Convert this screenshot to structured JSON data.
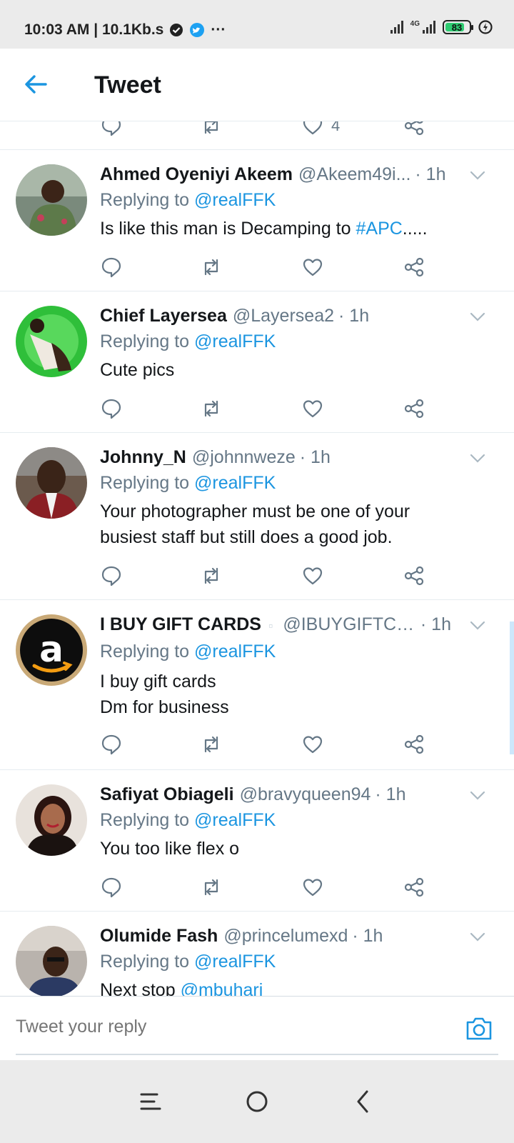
{
  "status_bar": {
    "time_speed": "10:03 AM | 10.1Kb.s",
    "more": "···",
    "network_type": "4G",
    "battery_level": "83"
  },
  "header": {
    "title": "Tweet"
  },
  "top_partial": {
    "like_count": "4"
  },
  "tweets": [
    {
      "name": "Ahmed Oyeniyi Akeem",
      "handle": "@Akeem49i...",
      "time": "· 1h",
      "replying_prefix": "Replying to",
      "replying_to": "@realFFK",
      "text_lines": [
        "Is like this man is Decamping to "
      ],
      "hashtag": "#APC",
      "text_suffix": "....."
    },
    {
      "name": "Chief Layersea",
      "handle": "@Layersea2",
      "time": "· 1h",
      "replying_prefix": "Replying to",
      "replying_to": "@realFFK",
      "text_lines": [
        "Cute pics"
      ]
    },
    {
      "name": "Johnny_N",
      "handle": "@johnnweze",
      "time": "· 1h",
      "replying_prefix": "Replying to",
      "replying_to": "@realFFK",
      "text_lines": [
        "Your photographer must be one of your",
        "busiest staff but still does a good job."
      ]
    },
    {
      "name": "I BUY GIFT CARDS",
      "handle": "@IBUYGIFTCA...",
      "time": "· 1h",
      "replying_prefix": "Replying to",
      "replying_to": "@realFFK",
      "text_lines": [
        "I buy gift cards",
        "Dm for business"
      ]
    },
    {
      "name": "Safiyat Obiageli",
      "handle": "@bravyqueen94",
      "time": "· 1h",
      "replying_prefix": "Replying to",
      "replying_to": "@realFFK",
      "text_lines": [
        "You too like flex o"
      ]
    },
    {
      "name": "Olumide Fash",
      "handle": "@princelumexd",
      "time": "· 1h",
      "replying_prefix": "Replying to",
      "replying_to": "@realFFK",
      "text_prefix": "Next stop ",
      "text_mention": "@mbuhari"
    }
  ],
  "composer": {
    "placeholder": "Tweet your reply"
  },
  "icons": {
    "back": "back-arrow-icon",
    "reply": "reply-icon",
    "retweet": "retweet-icon",
    "like": "heart-icon",
    "share": "share-icon",
    "caret": "chevron-down-icon",
    "camera": "camera-icon"
  },
  "colors": {
    "accent": "#1b95e0",
    "secondary_text": "#657786",
    "divider": "#e6ecf0"
  }
}
